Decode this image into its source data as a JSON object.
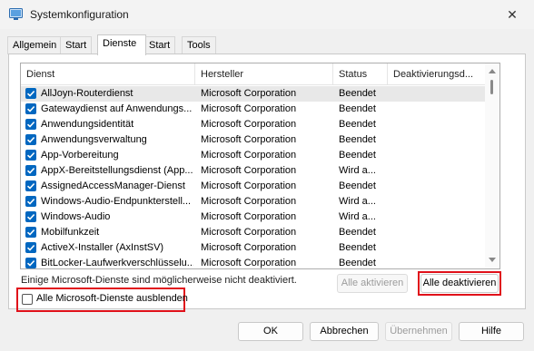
{
  "window": {
    "title": "Systemkonfiguration",
    "close_glyph": "✕"
  },
  "tabs": [
    {
      "label": "Allgemein"
    },
    {
      "label": "Start"
    },
    {
      "label": "Dienste",
      "active": true
    },
    {
      "label": "Start"
    },
    {
      "label": "Tools"
    }
  ],
  "services": {
    "columns": [
      "Dienst",
      "Hersteller",
      "Status",
      "Deaktivierungsd..."
    ],
    "rows": [
      {
        "name": "AllJoyn-Routerdienst",
        "vendor": "Microsoft Corporation",
        "status": "Beendet",
        "checked": true
      },
      {
        "name": "Gatewaydienst auf Anwendungs...",
        "vendor": "Microsoft Corporation",
        "status": "Beendet",
        "checked": true
      },
      {
        "name": "Anwendungsidentität",
        "vendor": "Microsoft Corporation",
        "status": "Beendet",
        "checked": true
      },
      {
        "name": "Anwendungsverwaltung",
        "vendor": "Microsoft Corporation",
        "status": "Beendet",
        "checked": true
      },
      {
        "name": "App-Vorbereitung",
        "vendor": "Microsoft Corporation",
        "status": "Beendet",
        "checked": true
      },
      {
        "name": "AppX-Bereitstellungsdienst (App...",
        "vendor": "Microsoft Corporation",
        "status": "Wird a...",
        "checked": true
      },
      {
        "name": "AssignedAccessManager-Dienst",
        "vendor": "Microsoft Corporation",
        "status": "Beendet",
        "checked": true
      },
      {
        "name": "Windows-Audio-Endpunkterstell...",
        "vendor": "Microsoft Corporation",
        "status": "Wird a...",
        "checked": true
      },
      {
        "name": "Windows-Audio",
        "vendor": "Microsoft Corporation",
        "status": "Wird a...",
        "checked": true
      },
      {
        "name": "Mobilfunkzeit",
        "vendor": "Microsoft Corporation",
        "status": "Beendet",
        "checked": true
      },
      {
        "name": "ActiveX-Installer (AxInstSV)",
        "vendor": "Microsoft Corporation",
        "status": "Beendet",
        "checked": true
      },
      {
        "name": "BitLocker-Laufwerkverschlüsselu...",
        "vendor": "Microsoft Corporation",
        "status": "Beendet",
        "checked": true
      }
    ]
  },
  "note": "Einige Microsoft-Dienste sind möglicherweise nicht deaktiviert.",
  "buttons": {
    "enable_all": "Alle aktivieren",
    "disable_all": "Alle deaktivieren",
    "ok": "OK",
    "cancel": "Abbrechen",
    "apply": "Übernehmen",
    "help": "Hilfe"
  },
  "hide_ms_services": {
    "label": "Alle Microsoft-Dienste ausblenden",
    "checked": false
  },
  "colors": {
    "highlight_border": "#e0101a",
    "checkbox_accent": "#0067c0"
  }
}
